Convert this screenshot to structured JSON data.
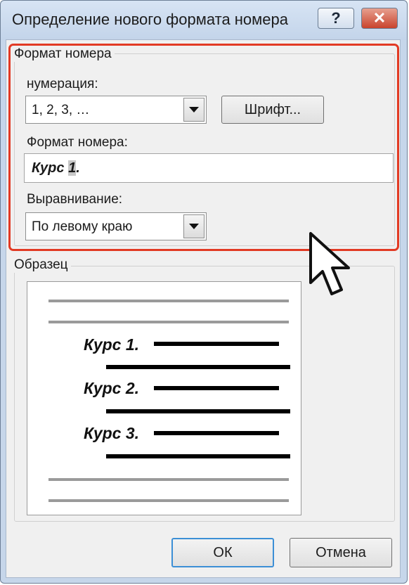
{
  "window": {
    "title": "Определение нового формата номера",
    "help_glyph": "?",
    "close_glyph": "✕"
  },
  "number_format_group": {
    "title": "Формат номера",
    "numbering_label": "нумерация:",
    "numbering_value": "1, 2, 3, …",
    "font_button": "Шрифт...",
    "format_label": "Формат номера:",
    "format_value_prefix": "Курс ",
    "format_value_selected": "1",
    "format_value_suffix": ".",
    "alignment_label": "Выравнивание:",
    "alignment_value": "По левому краю"
  },
  "sample_group": {
    "title": "Образец",
    "items": [
      "Курс 1.",
      "Курс 2.",
      "Курс 3."
    ]
  },
  "footer": {
    "ok_label": "ОК",
    "cancel_label": "Отмена"
  },
  "colors": {
    "highlight_border": "#e23a24",
    "titlebar": "#c6d6ea",
    "close_button": "#c9432d"
  },
  "icons": {
    "dropdown": "chevron-down-icon",
    "cursor": "mouse-pointer-icon",
    "help": "help-icon",
    "close": "close-icon"
  }
}
